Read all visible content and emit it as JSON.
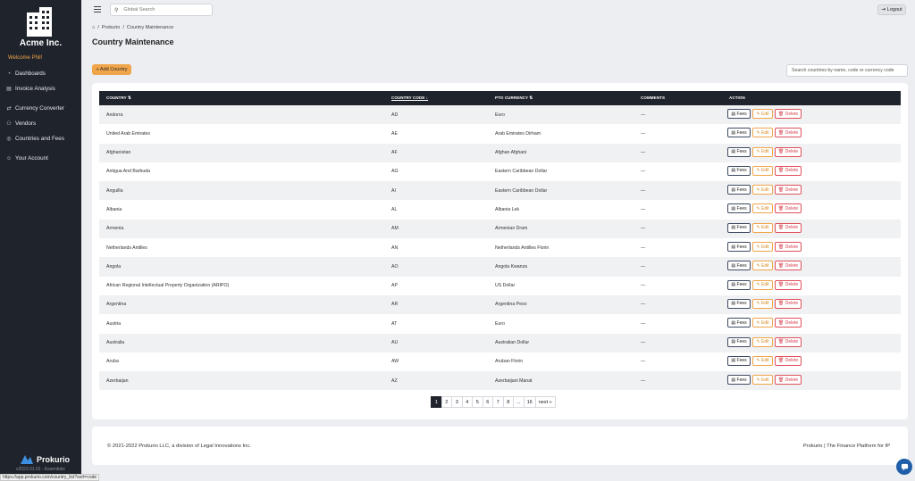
{
  "sidebar": {
    "brand": "Acme Inc.",
    "welcome": "Welcome Phil!",
    "items": [
      {
        "label": "Dashboards",
        "icon": "gauge-icon"
      },
      {
        "label": "Invoice Analysis",
        "icon": "document-icon"
      },
      {
        "label": "Currency Converter",
        "icon": "exchange-icon"
      },
      {
        "label": "Vendors",
        "icon": "users-icon"
      },
      {
        "label": "Countries and Fees",
        "icon": "globe-icon"
      },
      {
        "label": "Your Account",
        "icon": "user-icon"
      }
    ],
    "footer_brand": "Prokurio",
    "version": "v2023.01.01 - Essentials",
    "status_url": "https://app.prokurio.com/country_list?sort=code"
  },
  "topbar": {
    "search_placeholder": "Global Search",
    "logout_label": "Logout"
  },
  "breadcrumb": {
    "home_icon": "home-icon",
    "items": [
      "Prokurio",
      "Country Maintenance"
    ]
  },
  "page": {
    "title": "Country Maintenance",
    "add_button": "+ Add Country",
    "search_placeholder": "Search countries by name, code or currency code"
  },
  "table": {
    "headers": {
      "country": "COUNTRY",
      "code": "COUNTRY CODE",
      "currency": "PTO CURRENCY",
      "comments": "COMMENTS",
      "action": "ACTION"
    },
    "action_labels": {
      "fees": "Fees",
      "edit": "Edit",
      "delete": "Delete"
    },
    "rows": [
      {
        "country": "Andorra",
        "code": "AD",
        "currency": "Euro",
        "comments": "—"
      },
      {
        "country": "United Arab Emirates",
        "code": "AE",
        "currency": "Arab Emirates Dirham",
        "comments": "—"
      },
      {
        "country": "Afghanistan",
        "code": "AF",
        "currency": "Afghan Afghani",
        "comments": "—"
      },
      {
        "country": "Antigua And Barbuda",
        "code": "AG",
        "currency": "Eastern Caribbean Dollar",
        "comments": "—"
      },
      {
        "country": "Anguilla",
        "code": "AI",
        "currency": "Eastern Caribbean Dollar",
        "comments": "—"
      },
      {
        "country": "Albania",
        "code": "AL",
        "currency": "Albania Lek",
        "comments": "—"
      },
      {
        "country": "Armenia",
        "code": "AM",
        "currency": "Armenian Dram",
        "comments": "—"
      },
      {
        "country": "Netherlands Antilles",
        "code": "AN",
        "currency": "Netherlands Antilles Florin",
        "comments": "—"
      },
      {
        "country": "Angola",
        "code": "AO",
        "currency": "Angola Kwanza",
        "comments": "—"
      },
      {
        "country": "African Regional Intellectual Property Organization (ARIPO)",
        "code": "AP",
        "currency": "US Dollar",
        "comments": "—"
      },
      {
        "country": "Argentina",
        "code": "AR",
        "currency": "Argentina Peso",
        "comments": "—"
      },
      {
        "country": "Austria",
        "code": "AT",
        "currency": "Euro",
        "comments": "—"
      },
      {
        "country": "Australia",
        "code": "AU",
        "currency": "Australian Dollar",
        "comments": "—"
      },
      {
        "country": "Aruba",
        "code": "AW",
        "currency": "Aruban Florin",
        "comments": "—"
      },
      {
        "country": "Azerbaijan",
        "code": "AZ",
        "currency": "Azerbaijani Manat",
        "comments": "—"
      }
    ]
  },
  "pagination": {
    "pages": [
      "1",
      "2",
      "3",
      "4",
      "5",
      "6",
      "7",
      "8",
      "...",
      "16",
      "next »"
    ],
    "current": "1"
  },
  "footer": {
    "copyright": "© 2021-2022 Prokurio LLC, a division of Legal Innovations Inc.",
    "tagline": "Prokurio | The Finance Platform for IP"
  },
  "colors": {
    "sidebar_bg": "#1f232b",
    "accent": "#f0a54a",
    "danger": "#e0505b",
    "chat": "#1f5ea8"
  }
}
